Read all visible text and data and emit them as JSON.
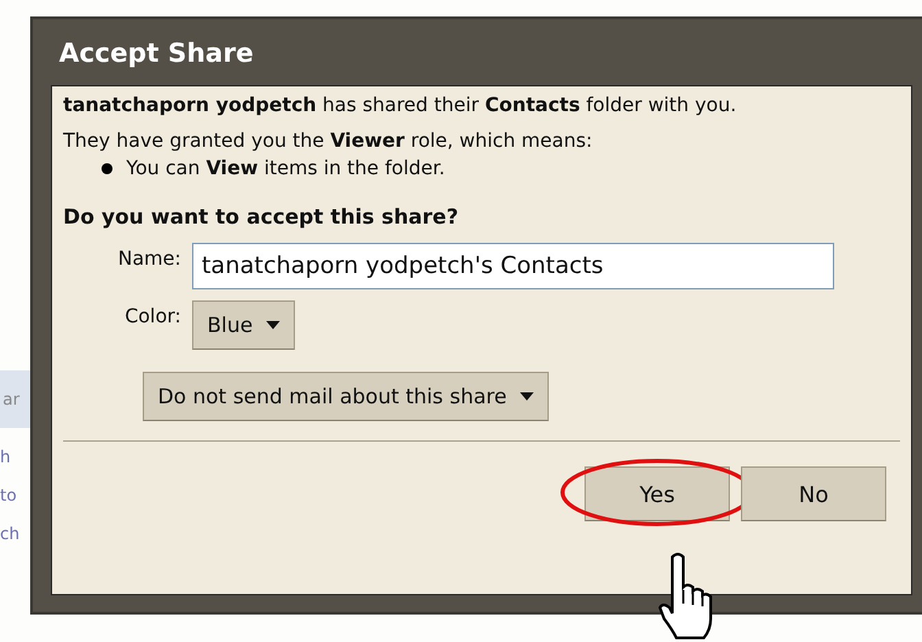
{
  "dialog": {
    "title": "Accept Share",
    "message": "**tanatchaporn yodpetch** has shared their **Contacts** folder with you.",
    "role_line": "They have granted you the **Viewer** role, which means:",
    "permissions": [
      "You can **View** items in the folder."
    ],
    "question": "Do you want to accept this share?",
    "name_field": {
      "label": "Name:",
      "value": "tanatchaporn yodpetch's Contacts"
    },
    "color_field": {
      "label": "Color:",
      "value": "Blue"
    },
    "mail_option": "Do not send mail about this share",
    "buttons": [
      {
        "label": "Yes",
        "highlighted": true
      },
      {
        "label": "No",
        "highlighted": false
      }
    ]
  },
  "background_fragments": [
    "ar",
    "h",
    "to",
    "ch"
  ]
}
